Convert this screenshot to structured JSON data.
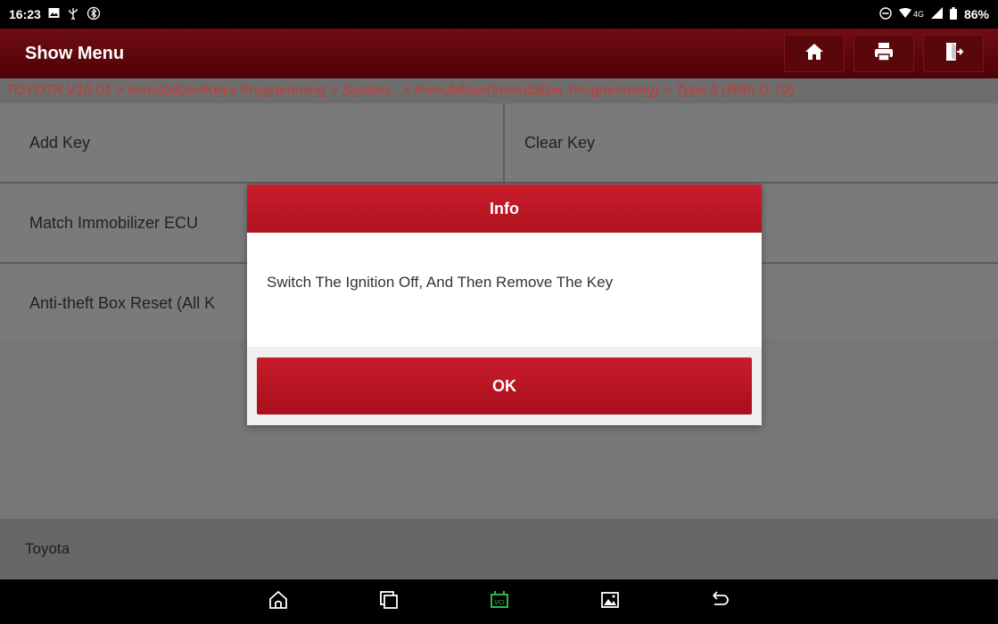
{
  "status_bar": {
    "time": "16:23",
    "network": "4G",
    "battery": "86%",
    "left_icons": [
      "image-notification-icon",
      "usb-icon",
      "bluetooth-icon"
    ],
    "right_icons": [
      "do-not-disturb-icon",
      "wifi-icon",
      "signal-icon",
      "battery-icon"
    ]
  },
  "header": {
    "title": "Show Menu",
    "buttons": [
      "home-icon",
      "print-icon",
      "exit-icon"
    ]
  },
  "breadcrumb": "TOYOTA V10.01 > Immobilizer/Keys Programming > System...> Immobiliser(Immobilizer Programming) > Type 5 (With G 72)",
  "menu": {
    "rows": [
      [
        "Add Key",
        "Clear Key"
      ],
      [
        "Match Immobilizer ECU",
        ""
      ],
      [
        "Anti-theft Box Reset (All K",
        ""
      ]
    ]
  },
  "footer": {
    "brand": "Toyota"
  },
  "dialog": {
    "title": "Info",
    "message": "Switch The Ignition Off, And Then Remove The Key",
    "ok_label": "OK"
  },
  "nav_bar": [
    "home-icon",
    "recent-apps-icon",
    "vci-icon",
    "gallery-icon",
    "back-icon"
  ],
  "colors": {
    "header_bg": "#5a070b",
    "dialog_title": "#c0182a",
    "breadcrumb_text": "#c73a31",
    "vci_green": "#2fb54a"
  }
}
